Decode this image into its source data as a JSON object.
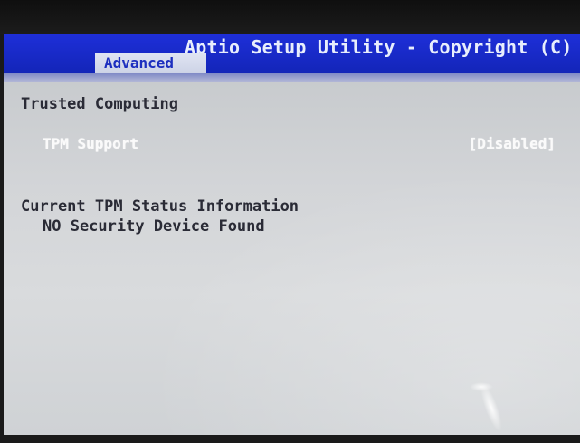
{
  "header": {
    "title": "Aptio Setup Utility - Copyright (C)",
    "active_tab": "Advanced"
  },
  "page": {
    "section_title": "Trusted Computing",
    "settings": [
      {
        "label": "TPM Support",
        "value": "[Disabled]"
      }
    ],
    "status_title": "Current TPM Status Information",
    "status_value": "NO Security Device Found"
  },
  "colors": {
    "header_blue": "#1e2fd8",
    "tab_background": "#dfe4f2",
    "content_gray": "#d3d5d8",
    "highlight_text": "#fafafa",
    "body_text": "#2a2b36"
  }
}
